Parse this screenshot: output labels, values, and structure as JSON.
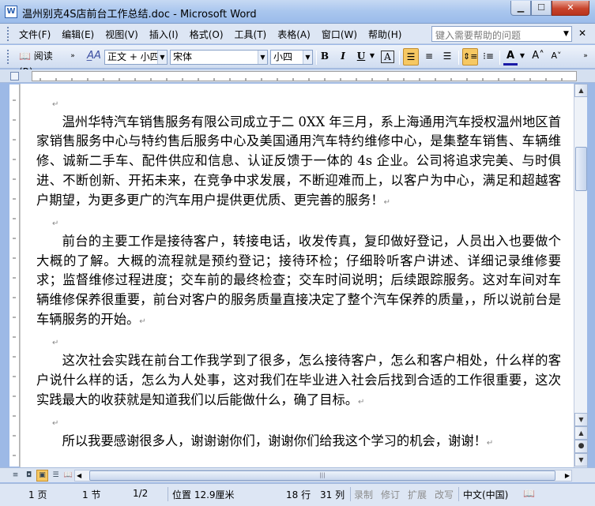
{
  "window": {
    "title": "温州别克4S店前台工作总结.doc - Microsoft Word",
    "icon": "word-doc-icon"
  },
  "menu": {
    "items": [
      "文件(F)",
      "编辑(E)",
      "视图(V)",
      "插入(I)",
      "格式(O)",
      "工具(T)",
      "表格(A)",
      "窗口(W)",
      "帮助(H)"
    ],
    "help_placeholder": "键入需要帮助的问题"
  },
  "toolbar": {
    "read_label": "阅读(R)",
    "style_value": "正文 + 小四",
    "font_value": "宋体",
    "size_value": "小四",
    "bold": "B",
    "italic": "I",
    "underline": "U",
    "char_border": "A",
    "accent_active": "#f6c863"
  },
  "document": {
    "paragraphs": [
      "温州华特汽车销售服务有限公司成立于二 0XX 年三月，系上海通用汽车授权温州地区首家销售服务中心与特约售后服务中心及美国通用汽车特约维修中心，是集整车销售、车辆维修、诚新二手车、配件供应和信息、认证反馈于一体的 4s 企业。公司将追求完美、与时俱进、不断创新、开拓未来，在竞争中求发展，不断迎难而上，以客户为中心，满足和超越客户期望，为更多更广的汽车用户提供更优质、更完善的服务！",
      "前台的主要工作是接待客户，转接电话，收发传真，复印做好登记，人员出入也要做个大概的了解。大概的流程就是预约登记；接待环检；仔细聆听客户讲述、详细记录维修要求；监督维修过程进度；交车前的最终检查；交车时间说明；后续跟踪服务。这对车间对车辆维修保养很重要，前台对客户的服务质量直接决定了整个汽车保养的质量，，所以说前台是车辆服务的开始。",
      "这次社会实践在前台工作我学到了很多，怎么接待客户，怎么和客户相处，什么样的客户说什么样的话，怎么为人处事，这对我们在毕业进入社会后找到合适的工作很重要，这次实践最大的收获就是知道我们以后能做什么，确了目标。",
      "所以我要感谢很多人，谢谢谢你们，谢谢你们给我这个学习的机会，谢谢！"
    ],
    "para_mark": "↵"
  },
  "statusbar": {
    "page": "1 页",
    "section": "1 节",
    "page_of": "1/2",
    "position": "位置 12.9厘米",
    "line": "18 行",
    "column": "31 列",
    "rec": "录制",
    "trk": "修订",
    "ext": "扩展",
    "ovr": "改写",
    "language": "中文(中国)"
  }
}
